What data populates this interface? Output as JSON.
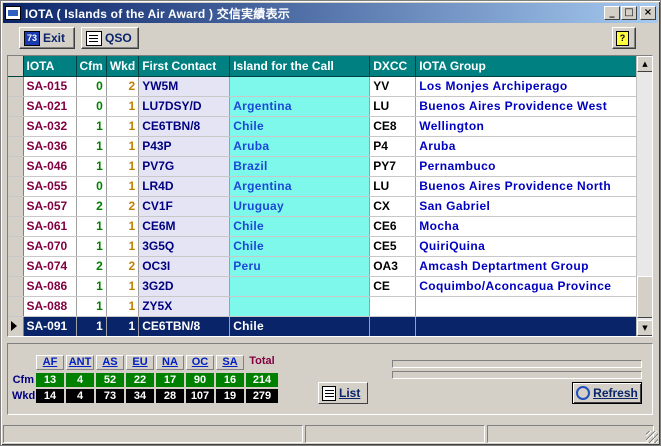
{
  "window": {
    "title": "IOTA ( Islands of the Air Award ) 交信実績表示"
  },
  "titlebar_buttons": {
    "minimize": "_",
    "maximize": "□",
    "close": "×"
  },
  "toolbar": {
    "exit_label": "Exit",
    "exit_icon_text": "73",
    "qso_label": "QSO",
    "help_icon_text": "?"
  },
  "table": {
    "columns": [
      "IOTA",
      "Cfm",
      "Wkd",
      "First Contact",
      "Island for the Call",
      "DXCC",
      "IOTA Group"
    ],
    "rows": [
      [
        "SA-015",
        "0",
        "2",
        "YW5M",
        "",
        "YV",
        "Los Monjes Archiperago"
      ],
      [
        "SA-021",
        "0",
        "1",
        "LU7DSY/D",
        "Argentina",
        "LU",
        "Buenos Aires Providence West"
      ],
      [
        "SA-032",
        "1",
        "1",
        "CE6TBN/8",
        "Chile",
        "CE8",
        "Wellington"
      ],
      [
        "SA-036",
        "1",
        "1",
        "P43P",
        "Aruba",
        "P4",
        "Aruba"
      ],
      [
        "SA-046",
        "1",
        "1",
        "PV7G",
        "Brazil",
        "PY7",
        "Pernambuco"
      ],
      [
        "SA-055",
        "0",
        "1",
        "LR4D",
        "Argentina",
        "LU",
        "Buenos Aires Providence North"
      ],
      [
        "SA-057",
        "2",
        "2",
        "CV1F",
        "Uruguay",
        "CX",
        "San Gabriel"
      ],
      [
        "SA-061",
        "1",
        "1",
        "CE6M",
        "Chile",
        "CE6",
        "Mocha"
      ],
      [
        "SA-070",
        "1",
        "1",
        "3G5Q",
        "Chile",
        "CE5",
        "QuiriQuina"
      ],
      [
        "SA-074",
        "2",
        "2",
        "OC3I",
        "Peru",
        "OA3",
        "Amcash Deptartment Group"
      ],
      [
        "SA-086",
        "1",
        "1",
        "3G2D",
        "",
        "CE",
        "Coquimbo/Aconcagua Province"
      ],
      [
        "SA-088",
        "1",
        "1",
        "ZY5X",
        "",
        "",
        ""
      ],
      [
        "SA-091",
        "1",
        "1",
        "CE6TBN/8",
        "Chile",
        "",
        ""
      ]
    ],
    "selected_index": 12
  },
  "scrollbar": {
    "up": "▲",
    "down": "▼"
  },
  "stats": {
    "row_labels": {
      "cfm": "Cfm",
      "wkd": "Wkd"
    },
    "columns": [
      "AF",
      "ANT",
      "AS",
      "EU",
      "NA",
      "OC",
      "SA",
      "Total"
    ],
    "cfm": [
      "13",
      "4",
      "52",
      "22",
      "17",
      "90",
      "16",
      "214"
    ],
    "wkd": [
      "14",
      "4",
      "73",
      "34",
      "28",
      "107",
      "19",
      "279"
    ]
  },
  "buttons": {
    "list_label": "List",
    "refresh_label": "Refresh"
  }
}
